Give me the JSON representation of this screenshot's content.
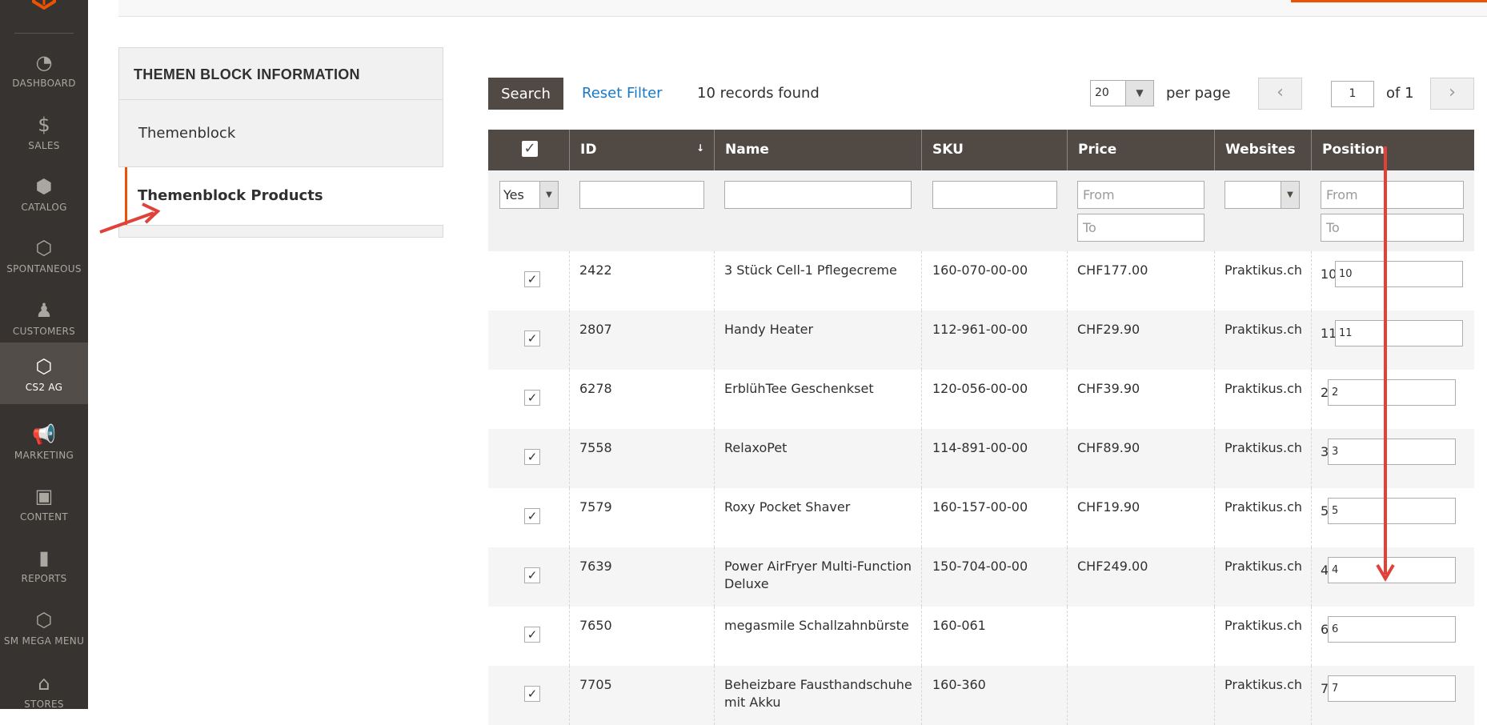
{
  "sidebar": {
    "items": [
      {
        "label": "DASHBOARD",
        "icon": "dashboard-icon",
        "glyph": "◔"
      },
      {
        "label": "SALES",
        "icon": "dollar-icon",
        "glyph": "$"
      },
      {
        "label": "CATALOG",
        "icon": "cube-icon",
        "glyph": "⬢"
      },
      {
        "label": "SPONTANEOUS",
        "icon": "hexagon-icon",
        "glyph": "⬡"
      },
      {
        "label": "CUSTOMERS",
        "icon": "person-icon",
        "glyph": "♟"
      },
      {
        "label": "CS2 AG",
        "icon": "hexagon-icon",
        "glyph": "⬡"
      },
      {
        "label": "MARKETING",
        "icon": "megaphone-icon",
        "glyph": "📢"
      },
      {
        "label": "CONTENT",
        "icon": "layout-icon",
        "glyph": "▣"
      },
      {
        "label": "REPORTS",
        "icon": "bar-chart-icon",
        "glyph": "▮"
      },
      {
        "label": "SM MEGA MENU",
        "icon": "hexagon-icon",
        "glyph": "⬡"
      },
      {
        "label": "STORES",
        "icon": "store-icon",
        "glyph": "⌂"
      }
    ]
  },
  "tabs": {
    "title": "THEMEN BLOCK INFORMATION",
    "items": [
      "Themenblock",
      "Themenblock Products"
    ]
  },
  "toolbar": {
    "search_label": "Search",
    "reset_label": "Reset Filter",
    "records_text": "10 records found",
    "per_page_value": "20",
    "per_page_label": "per page",
    "prev_glyph": "‹",
    "next_glyph": "›",
    "page_value": "1",
    "of_pages": "of 1"
  },
  "grid": {
    "columns": [
      "ID",
      "Name",
      "SKU",
      "Price",
      "Websites",
      "Position"
    ],
    "filters": {
      "in_products": "Yes",
      "price_from": "From",
      "price_to": "To",
      "position_from": "From",
      "position_to": "To"
    },
    "rows": [
      {
        "id": "2422",
        "name": "3 Stück Cell-1 Pflegecreme",
        "name2": "",
        "sku": "160-070-00-00",
        "price": "CHF177.00",
        "website": "Praktikus.ch",
        "pos_label": "10",
        "pos_value": "10"
      },
      {
        "id": "2807",
        "name": "Handy Heater",
        "name2": "",
        "sku": "112-961-00-00",
        "price": "CHF29.90",
        "website": "Praktikus.ch",
        "pos_label": "11",
        "pos_value": "11"
      },
      {
        "id": "6278",
        "name": "ErblühTee Geschenkset",
        "name2": "",
        "sku": "120-056-00-00",
        "price": "CHF39.90",
        "website": "Praktikus.ch",
        "pos_label": "2",
        "pos_value": "2"
      },
      {
        "id": "7558",
        "name": "RelaxoPet",
        "name2": "",
        "sku": "114-891-00-00",
        "price": "CHF89.90",
        "website": "Praktikus.ch",
        "pos_label": "3",
        "pos_value": "3"
      },
      {
        "id": "7579",
        "name": "Roxy Pocket Shaver",
        "name2": "",
        "sku": "160-157-00-00",
        "price": "CHF19.90",
        "website": "Praktikus.ch",
        "pos_label": "5",
        "pos_value": "5"
      },
      {
        "id": "7639",
        "name": "Power AirFryer Multi-Function",
        "name2": "Deluxe",
        "sku": "150-704-00-00",
        "price": "CHF249.00",
        "website": "Praktikus.ch",
        "pos_label": "4",
        "pos_value": "4"
      },
      {
        "id": "7650",
        "name": "megasmile Schallzahnbürste",
        "name2": "",
        "sku": "160-061",
        "price": "",
        "website": "Praktikus.ch",
        "pos_label": "6",
        "pos_value": "6"
      },
      {
        "id": "7705",
        "name": "Beheizbare Fausthandschuhe",
        "name2": "mit Akku",
        "sku": "160-360",
        "price": "",
        "website": "Praktikus.ch",
        "pos_label": "7",
        "pos_value": "7"
      }
    ]
  },
  "colors": {
    "sidebar_bg": "#373330",
    "header_bg": "#514943",
    "accent": "#eb5202",
    "link": "#1979c3",
    "annotation": "#e0423a"
  }
}
